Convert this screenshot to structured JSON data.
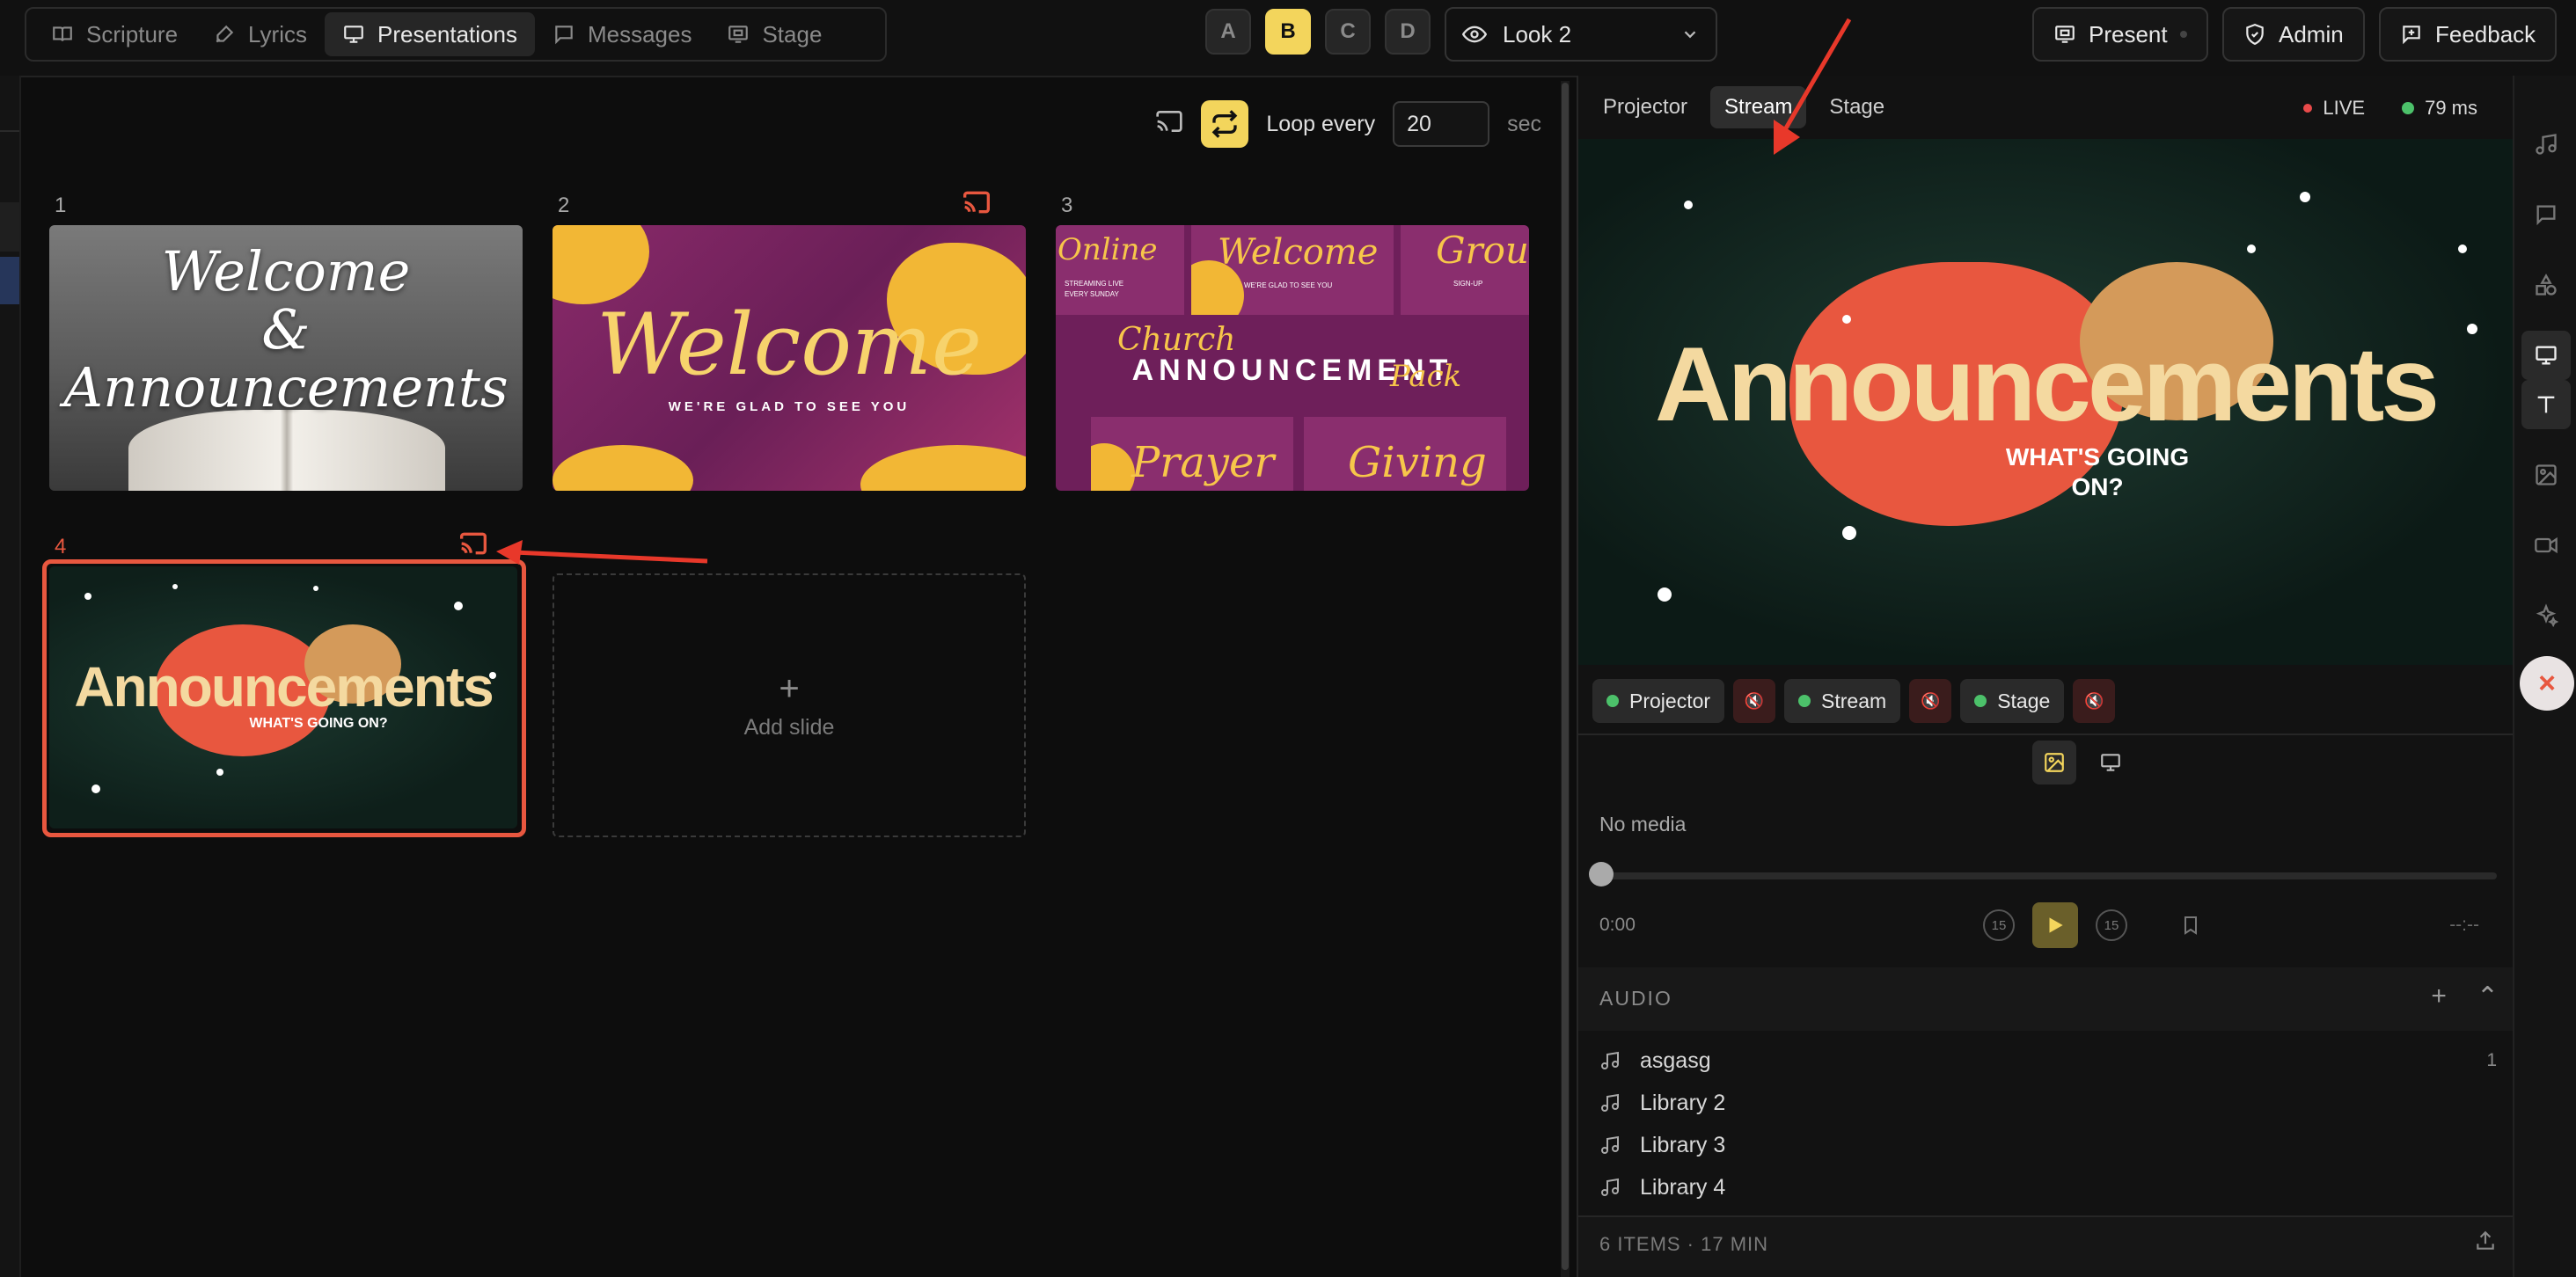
{
  "nav": {
    "tabs": [
      {
        "label": "Scripture",
        "icon": "book-icon"
      },
      {
        "label": "Lyrics",
        "icon": "microphone-icon"
      },
      {
        "label": "Presentations",
        "icon": "presentation-icon",
        "active": true
      },
      {
        "label": "Messages",
        "icon": "message-icon"
      },
      {
        "label": "Stage",
        "icon": "stage-icon"
      }
    ]
  },
  "looks": {
    "buttons": [
      "A",
      "B",
      "C",
      "D"
    ],
    "active": "B",
    "selected": "Look 2"
  },
  "top_actions": {
    "present": "Present",
    "admin": "Admin",
    "feedback": "Feedback"
  },
  "loop": {
    "label": "Loop every",
    "value": "20",
    "unit": "sec"
  },
  "slides": [
    {
      "number": "1",
      "title": "Welcome",
      "amp": "&",
      "subtitle": "Announcements"
    },
    {
      "number": "2",
      "title": "Welcome",
      "subtitle": "WE'RE GLAD TO SEE YOU",
      "cast": true
    },
    {
      "number": "3",
      "main": "ANNOUNCEMENT",
      "cells": [
        "Online",
        "Welcome",
        "Group",
        "Church",
        "Pack",
        "Prayer",
        "Giving"
      ],
      "small": [
        "STREAMING LIVE",
        "EVERY SUNDAY",
        "WE'RE GLAD TO SEE YOU",
        "SIGN-UP"
      ]
    },
    {
      "number": "4",
      "title": "Announcements",
      "subtitle": "WHAT'S GOING ON?",
      "cast": true,
      "selected": true
    }
  ],
  "add_slide": "Add slide",
  "output": {
    "tabs": [
      "Projector",
      "Stream",
      "Stage"
    ],
    "active_tab": "Stream",
    "live": "LIVE",
    "latency": "79 ms",
    "preview_title": "Announcements",
    "preview_subtitle_1": "WHAT'S GOING",
    "preview_subtitle_2": "ON?",
    "channels": [
      "Projector",
      "Stream",
      "Stage"
    ]
  },
  "media": {
    "status": "No media",
    "time_start": "0:00",
    "time_end": "--:--",
    "skip_back": "15",
    "skip_forward": "15"
  },
  "audio": {
    "header": "AUDIO",
    "items": [
      {
        "label": "asgasg",
        "count": "1"
      },
      {
        "label": "Library 2",
        "count": ""
      },
      {
        "label": "Library 3",
        "count": ""
      },
      {
        "label": "Library 4",
        "count": ""
      }
    ],
    "footer": "6 ITEMS · 17 MIN"
  },
  "colors": {
    "accent": "#f3d55c",
    "live": "#e84a4a",
    "ok": "#4cc16a",
    "selection": "#e8573f"
  }
}
